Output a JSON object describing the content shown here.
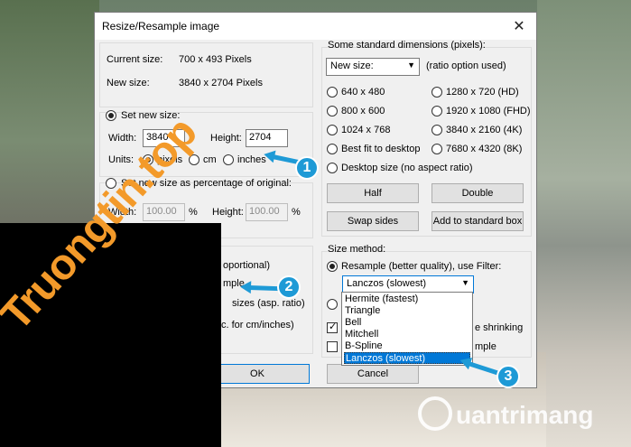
{
  "dialog": {
    "title": "Resize/Resample image",
    "close_glyph": "✕",
    "current_size_label": "Current size:",
    "current_size_value": "700  x  493  Pixels",
    "new_size_label": "New size:",
    "new_size_value": "3840  x  2704  Pixels",
    "set_new_size_label": "Set new size:",
    "width_label": "Width:",
    "width_value": "3840",
    "height_label": "Height:",
    "height_value": "2704",
    "units_label": "Units:",
    "units": [
      "pixels",
      "cm",
      "inches"
    ],
    "percent_label": "Set new size as percentage of original:",
    "pct_width_label": "Width:",
    "pct_width_value": "100.00",
    "pct_height_label": "Height:",
    "pct_height_value": "100.00",
    "pct_sign": "%",
    "partial_proportional": "oportional)",
    "partial_mple": "mple",
    "partial_sizes": "sizes (asp. ratio)",
    "partial_cm": "c. for cm/inches)",
    "std_dims_label": "Some standard dimensions (pixels):",
    "new_size_select": "New size:",
    "ratio_note": "(ratio option used)",
    "std_options": [
      "640 x 480",
      "1280 x 720  (HD)",
      "800 x 600",
      "1920 x 1080 (FHD)",
      "1024 x 768",
      "3840 x 2160 (4K)",
      "Best fit to desktop",
      "7680 x 4320 (8K)"
    ],
    "desktop_size": "Desktop size (no aspect ratio)",
    "btn_half": "Half",
    "btn_double": "Double",
    "btn_swap": "Swap sides",
    "btn_add_standard": "Add to standard box",
    "size_method_label": "Size method:",
    "resample_label": "Resample (better quality), use Filter:",
    "filter_selected": "Lanczos (slowest)",
    "filter_options": [
      "Hermite (fastest)",
      "Triangle",
      "Bell",
      "Mitchell",
      "B-Spline",
      "Lanczos (slowest)"
    ],
    "partial_shrinking": "e shrinking",
    "partial_mple2": "mple",
    "btn_ok": "OK",
    "btn_cancel": "Cancel"
  },
  "watermark": {
    "main": "Truongtin",
    "tld": ".top"
  },
  "badges": [
    "1",
    "2",
    "3"
  ],
  "logo": {
    "text": "uantrimang"
  },
  "colors": {
    "accent": "#0078d7",
    "badge": "#1e9ad6",
    "watermark": "#f39a2a"
  }
}
